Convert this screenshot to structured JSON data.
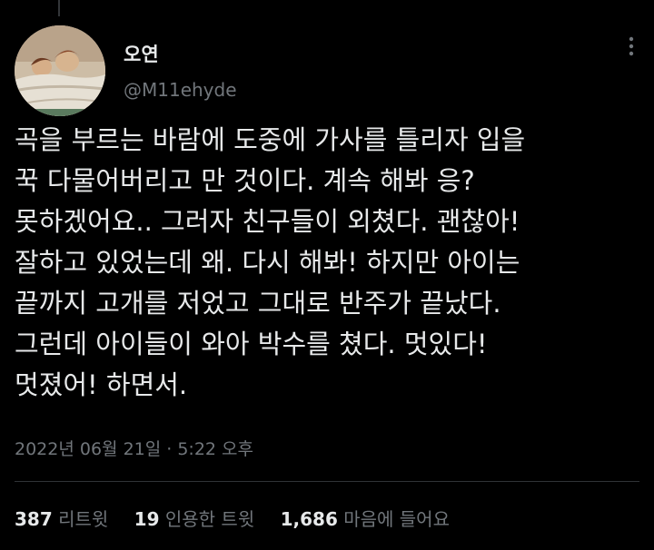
{
  "tweet": {
    "display_name": "오연",
    "handle": "@M11ehyde",
    "text_lines": [
      "곡을 부르는 바람에 도중에 가사를 틀리자 입을",
      "꾹 다물어버리고 만 것이다. 계속 해봐 응?",
      "못하겠어요.. 그러자 친구들이 외쳤다. 괜찮아!",
      "잘하고 있었는데 왜. 다시 해봐! 하지만 아이는",
      "끝까지 고개를 저었고 그대로 반주가 끝났다.",
      "그런데 아이들이 와아 박수를 쳤다. 멋있다!",
      "멋졌어! 하면서."
    ],
    "timestamp": "2022년 06월 21일 · 5:22 오후"
  },
  "stats": {
    "retweets": {
      "count": "387",
      "label": "리트윗"
    },
    "quotes": {
      "count": "19",
      "label": "인용한 트윗"
    },
    "likes": {
      "count": "1,686",
      "label": "마음에 들어요"
    }
  },
  "icons": {
    "more": "more-dots-icon"
  },
  "colors": {
    "background": "#000000",
    "text_primary": "#e7e9ea",
    "text_secondary": "#71767b",
    "divider": "#2f3336"
  }
}
